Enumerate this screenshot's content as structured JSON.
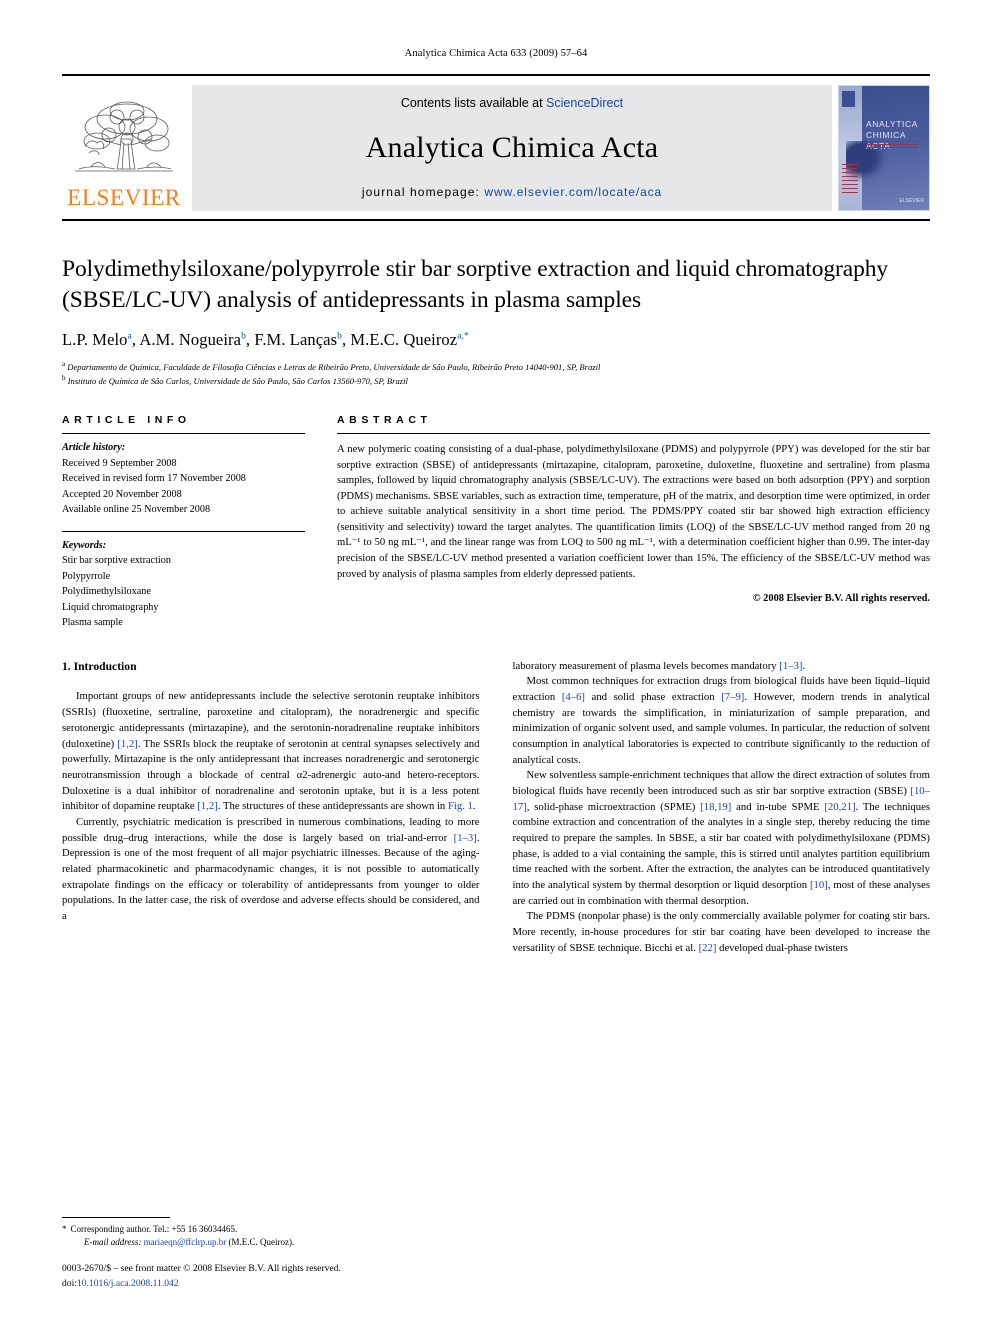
{
  "running_head": "Analytica Chimica Acta 633 (2009) 57–64",
  "masthead": {
    "contents_prefix": "Contents lists available at ",
    "sciencedirect": "ScienceDirect",
    "journal_title": "Analytica Chimica Acta",
    "homepage_prefix": "journal homepage: ",
    "homepage_url": "www.elsevier.com/locate/aca",
    "publisher": "ELSEVIER",
    "cover_title": "ANALYTICA CHIMICA ACTA",
    "cover_footer": "ELSEVIER",
    "accent_orange": "#f0801a",
    "link_blue": "#1a45a0",
    "band_gray": "#e6e7e9"
  },
  "article": {
    "title": "Polydimethylsiloxane/polypyrrole stir bar sorptive extraction and liquid chromatography (SBSE/LC-UV) analysis of antidepressants in plasma samples",
    "authors_html": "L.P. Melo<sup>a</sup>, A.M. Nogueira<sup>b</sup>, F.M. Lanças<sup>b</sup>, M.E.C. Queiroz<sup>a,</sup><sup class=\"star\">*</sup>",
    "affiliation_a": "Departamento de Química, Faculdade de Filosofia Ciências e Letras de Ribeirão Preto, Universidade de São Paulo, Ribeirão Preto 14040-901, SP, Brazil",
    "affiliation_b": "Instituto de Química de São Carlos, Universidade de São Paulo, São Carlos 13560-970, SP, Brazil"
  },
  "article_info": {
    "heading": "ARTICLE INFO",
    "history_label": "Article history:",
    "history": [
      "Received 9 September 2008",
      "Received in revised form 17 November 2008",
      "Accepted 20 November 2008",
      "Available online 25 November 2008"
    ],
    "keywords_label": "Keywords:",
    "keywords": [
      "Stir bar sorptive extraction",
      "Polypyrrole",
      "Polydimethylsiloxane",
      "Liquid chromatography",
      "Plasma sample"
    ]
  },
  "abstract": {
    "heading": "ABSTRACT",
    "text": "A new polymeric coating consisting of a dual-phase, polydimethylsiloxane (PDMS) and polypyrrole (PPY) was developed for the stir bar sorptive extraction (SBSE) of antidepressants (mirtazapine, citalopram, paroxetine, duloxetine, fluoxetine and sertraline) from plasma samples, followed by liquid chromatography analysis (SBSE/LC-UV). The extractions were based on both adsorption (PPY) and sorption (PDMS) mechanisms. SBSE variables, such as extraction time, temperature, pH of the matrix, and desorption time were optimized, in order to achieve suitable analytical sensitivity in a short time period. The PDMS/PPY coated stir bar showed high extraction efficiency (sensitivity and selectivity) toward the target analytes. The quantification limits (LOQ) of the SBSE/LC-UV method ranged from 20 ng mL⁻¹ to 50 ng mL⁻¹, and the linear range was from LOQ to 500 ng mL⁻¹, with a determination coefficient higher than 0.99. The inter-day precision of the SBSE/LC-UV method presented a variation coefficient lower than 15%. The efficiency of the SBSE/LC-UV method was proved by analysis of plasma samples from elderly depressed patients.",
    "copyright": "© 2008 Elsevier B.V. All rights reserved."
  },
  "introduction": {
    "section_number_title": "1. Introduction",
    "left_paragraphs": [
      "Important groups of new antidepressants include the selective serotonin reuptake inhibitors (SSRIs) (fluoxetine, sertraline, paroxetine and citalopram), the noradrenergic and specific serotonergic antidepressants (mirtazapine), and the serotonin-noradrenaline reuptake inhibitors (duloxetine) <a class=\"ref\">[1,2]</a>. The SSRIs block the reuptake of serotonin at central synapses selectively and powerfully. Mirtazapine is the only antidepressant that increases noradrenergic and serotonergic neurotransmission through a blockade of central α2-adrenergic auto-and hetero-receptors. Duloxetine is a dual inhibitor of noradrenaline and serotonin uptake, but it is a less potent inhibitor of dopamine reuptake <a class=\"ref\">[1,2]</a>. The structures of these antidepressants are shown in <a class=\"ref\">Fig. 1</a>.",
      "Currently, psychiatric medication is prescribed in numerous combinations, leading to more possible drug–drug interactions, while the dose is largely based on trial-and-error <a class=\"ref\">[1–3]</a>. Depression is one of the most frequent of all major psychiatric illnesses. Because of the aging-related pharmacokinetic and pharmacodynamic changes, it is not possible to automatically extrapolate findings on the efficacy or tolerability of antidepressants from younger to older populations. In the latter case, the risk of overdose and adverse effects should be considered, and a"
    ],
    "right_paragraphs": [
      "laboratory measurement of plasma levels becomes mandatory <a class=\"ref\">[1–3]</a>.",
      "Most common techniques for extraction drugs from biological fluids have been liquid–liquid extraction <a class=\"ref\">[4–6]</a> and solid phase extraction <a class=\"ref\">[7–9]</a>. However, modern trends in analytical chemistry are towards the simplification, in miniaturization of sample preparation, and minimization of organic solvent used, and sample volumes. In particular, the reduction of solvent consumption in analytical laboratories is expected to contribute significantly to the reduction of analytical costs.",
      "New solventless sample-enrichment techniques that allow the direct extraction of solutes from biological fluids have recently been introduced such as stir bar sorptive extraction (SBSE) <a class=\"ref\">[10–17]</a>, solid-phase microextraction (SPME) <a class=\"ref\">[18,19]</a> and in-tube SPME <a class=\"ref\">[20,21]</a>. The techniques combine extraction and concentration of the analytes in a single step, thereby reducing the time required to prepare the samples. In SBSE, a stir bar coated with polydimethylsiloxane (PDMS) phase, is added to a vial containing the sample, this is stirred until analytes partition equilibrium time reached with the sorbent. After the extraction, the analytes can be introduced quantitatively into the analytical system by thermal desorption or liquid desorption <a class=\"ref\">[10]</a>, most of these analyses are carried out in combination with thermal desorption.",
      "The PDMS (nonpolar phase) is the only commercially available polymer for coating stir bars. More recently, in-house procedures for stir bar coating have been developed to increase the versatility of SBSE technique. Bicchi et al. <a class=\"ref\">[22]</a> developed dual-phase twisters"
    ]
  },
  "footnotes": {
    "corresponding": "Corresponding author. Tel.: +55 16 36034465.",
    "star": "*",
    "email_label": "E-mail address:",
    "email": "mariaeqn@ffclrp.up.br",
    "email_owner": "(M.E.C. Queiroz)."
  },
  "imprint": {
    "line1": "0003-2670/$ – see front matter © 2008 Elsevier B.V. All rights reserved.",
    "doi_label": "doi:",
    "doi": "10.1016/j.aca.2008.11.042"
  }
}
